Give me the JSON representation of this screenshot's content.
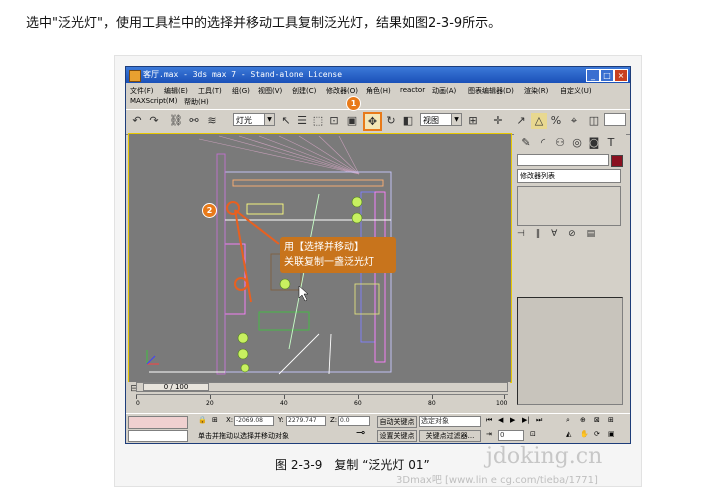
{
  "intro_text": "选中\"泛光灯\"，使用工具栏中的选择并移动工具复制泛光灯，结果如图2-3-9所示。",
  "window": {
    "title": "客厅.max - 3ds max 7 - Stand-alone License",
    "btn_min": "_",
    "btn_max": "□",
    "btn_close": "×"
  },
  "menu": {
    "row1": [
      "文件(F)",
      "编辑(E)",
      "工具(T)",
      "组(G)",
      "视图(V)",
      "创建(C)",
      "修改器(O)",
      "角色(H)",
      "reactor",
      "动画(A)",
      "图表编辑器(D)",
      "渲染(R)",
      "自定义(U)"
    ],
    "row2": [
      "MAXScript(M)",
      "帮助(H)"
    ]
  },
  "toolbar": {
    "filter_value": "灯光",
    "refcoord_value": "视图"
  },
  "callout": {
    "line1": "用【选择并移动】",
    "line2": "关联复制一盏泛光灯"
  },
  "badges": {
    "step1": "1",
    "step2": "2"
  },
  "rightpanel": {
    "modifier_list": "修改器列表"
  },
  "timeline": {
    "slider_label": "0 / 100",
    "ticks": [
      "0",
      "20",
      "40",
      "60",
      "80",
      "100"
    ]
  },
  "status": {
    "x_label": "X:",
    "x_value": "-2069.08",
    "y_label": "Y:",
    "y_value": "2279.747",
    "z_label": "Z:",
    "z_value": "0.0",
    "auto_key": "自动关键点",
    "selected_object": "选定对象",
    "set_key": "设置关键点",
    "key_filters": "关键点过滤器...",
    "frame_value": "0",
    "prompt": "单击并拖动以选择并移动对象"
  },
  "caption": "图 2-3-9　复制 “泛光灯 01”",
  "watermark": {
    "line1": "jdoking.cn",
    "line2": "3Dmax吧 [www.lin e cg.com/tieba/1771]"
  },
  "colors": {
    "callout": "#c8741c",
    "badge": "#e87a1a",
    "viewport_bg": "#7a7a7a",
    "titlebar": "#2a5fc8"
  }
}
